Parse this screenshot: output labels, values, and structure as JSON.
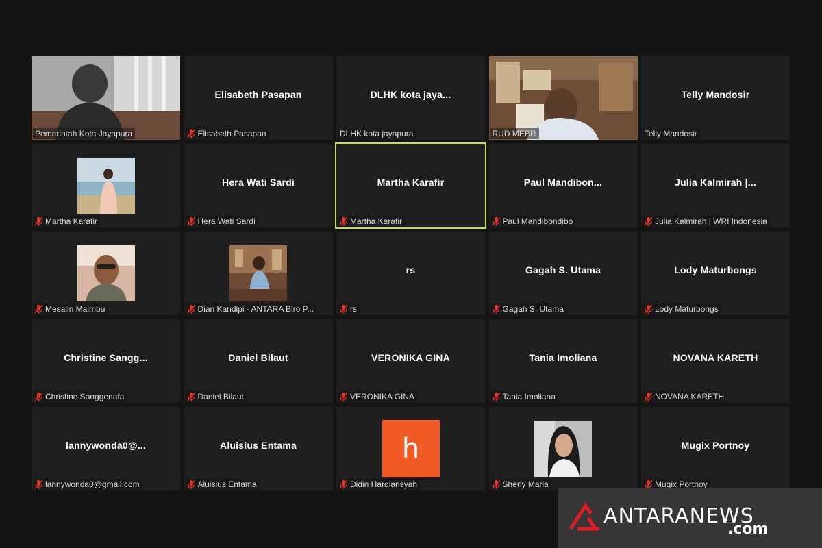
{
  "participants": [
    {
      "display": "",
      "caption": "Pemerintah Kota Jayapura",
      "muted": false,
      "video": "person-room"
    },
    {
      "display": "Elisabeth Pasapan",
      "caption": "Elisabeth Pasapan",
      "muted": true
    },
    {
      "display": "DLHK  kota  jaya...",
      "caption": "DLHK kota jayapura",
      "muted": false
    },
    {
      "display": "",
      "caption": "RUD MEBR",
      "muted": false,
      "video": "man-office"
    },
    {
      "display": "Telly Mandosir",
      "caption": "Telly Mandosir",
      "muted": false
    },
    {
      "display": "",
      "caption": "Martha Karafir",
      "muted": true,
      "photo": "woman-beach"
    },
    {
      "display": "Hera Wati Sardi",
      "caption": "Hera Wati Sardi",
      "muted": true
    },
    {
      "display": "Martha Karafir",
      "caption": "Martha Karafir",
      "muted": true,
      "active": true
    },
    {
      "display": "Paul  Mandibon...",
      "caption": "Paul Mandibondibo",
      "muted": true
    },
    {
      "display": "Julia  Kalmirah  |...",
      "caption": "Julia Kalmirah | WRI Indonesia",
      "muted": true
    },
    {
      "display": "",
      "caption": "Mesalin Maimbu",
      "muted": true,
      "photo": "man-glasses"
    },
    {
      "display": "",
      "caption": "Dian Kandipi - ANTARA Biro P...",
      "muted": true,
      "photo": "woman-office"
    },
    {
      "display": "rs",
      "caption": "rs",
      "muted": true
    },
    {
      "display": "Gagah S. Utama",
      "caption": "Gagah S. Utama",
      "muted": true
    },
    {
      "display": "Lody Maturbongs",
      "caption": "Lody Maturbongs",
      "muted": true
    },
    {
      "display": "Christine  Sangg...",
      "caption": "Christine Sanggenafa",
      "muted": true
    },
    {
      "display": "Daniel Bilaut",
      "caption": "Daniel Bilaut",
      "muted": true
    },
    {
      "display": "VERONIKA GINA",
      "caption": "VERONIKA GINA",
      "muted": true
    },
    {
      "display": "Tania Imoliana",
      "caption": "Tania Imoliana",
      "muted": true
    },
    {
      "display": "NOVANA KARETH",
      "caption": "NOVANA KARETH",
      "muted": true
    },
    {
      "display": "lannywonda0@...",
      "caption": "lannywonda0@gmail.com",
      "muted": true
    },
    {
      "display": "Aluisius Entama",
      "caption": "Aluisius Entama",
      "muted": true
    },
    {
      "display": "",
      "caption": "Didin Hardiansyah",
      "muted": true,
      "avatar_letter": "h",
      "avatar_color": "#f15a24"
    },
    {
      "display": "",
      "caption": "Sherly Maria",
      "muted": true,
      "photo": "woman-portrait"
    },
    {
      "display": "Mugix Portnoy",
      "caption": "Mugix Portnoy",
      "muted": true
    }
  ],
  "watermark": {
    "brand": "ANTARANEWS",
    "suffix": ".com"
  },
  "colors": {
    "active_border": "#c6e24a",
    "muted_icon": "#e0352b",
    "tile_bg": "#1f1f1f"
  }
}
